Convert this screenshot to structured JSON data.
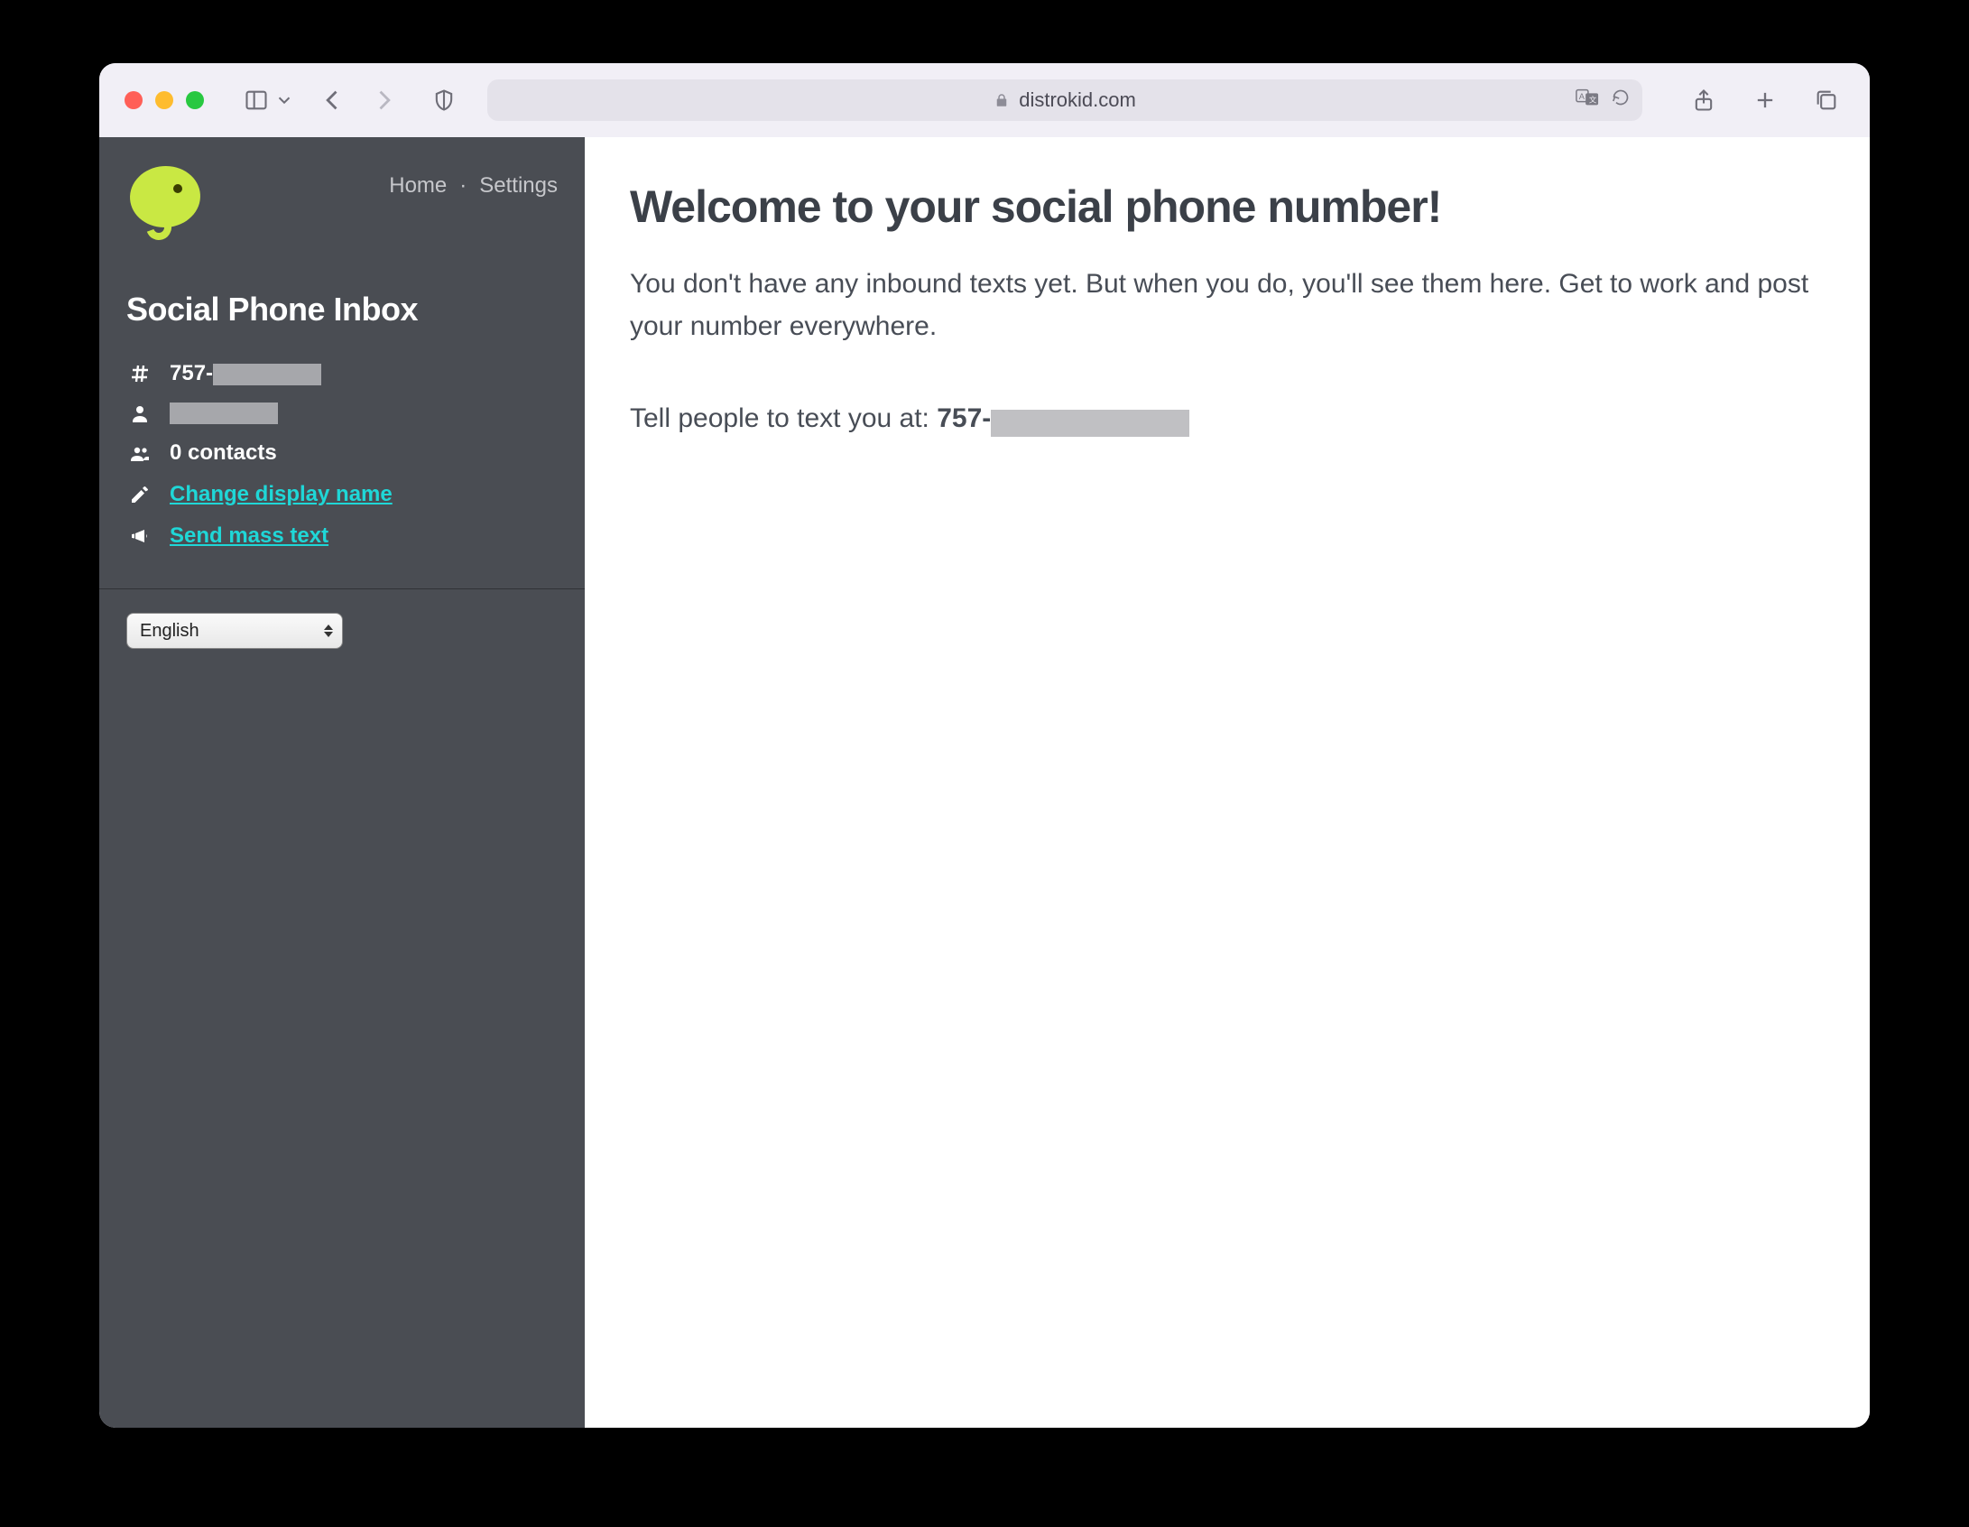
{
  "browser": {
    "domain": "distrokid.com"
  },
  "sidebar": {
    "nav": {
      "home": "Home",
      "separator": "·",
      "settings": "Settings"
    },
    "title": "Social Phone Inbox",
    "phone_prefix": "757-",
    "contacts_label": "0 contacts",
    "change_name_label": "Change display name",
    "send_mass_label": "Send mass text",
    "language_selected": "English"
  },
  "main": {
    "heading": "Welcome to your social phone number!",
    "body": "You don't have any inbound texts yet. But when you do, you'll see them here. Get to work and post your number everywhere.",
    "tell_prefix": "Tell people to text you at: ",
    "tell_number_prefix": "757-"
  }
}
